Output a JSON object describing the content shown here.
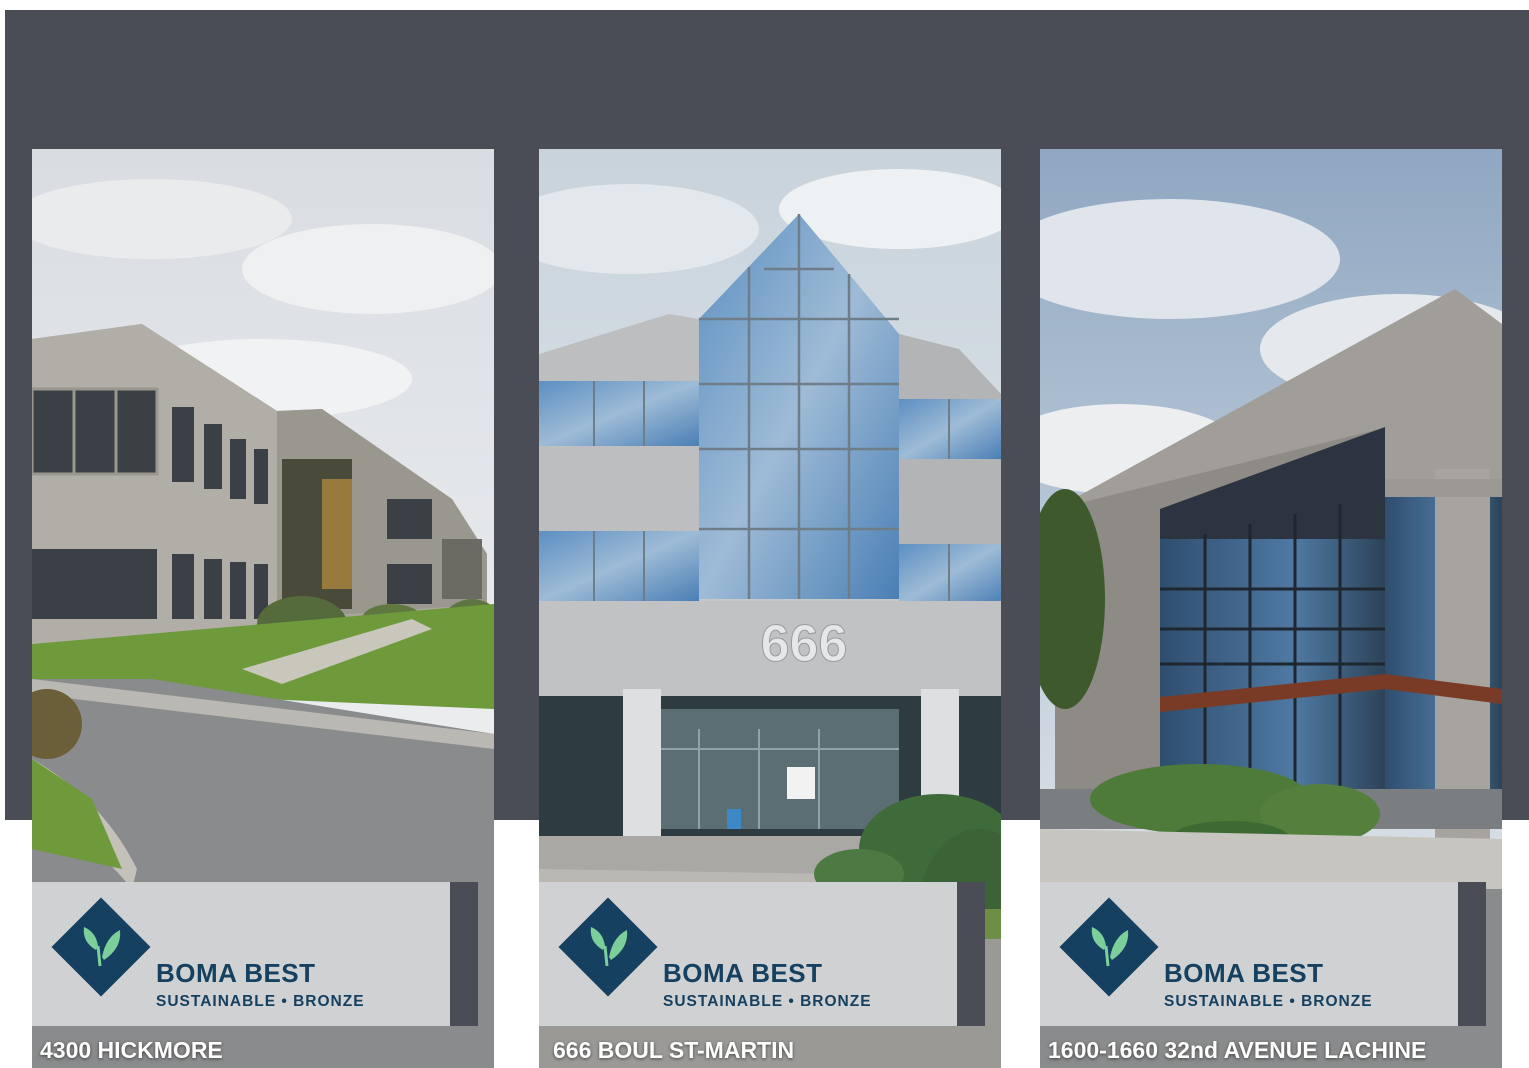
{
  "badge": {
    "title": "BOMA BEST",
    "subtitle": "SUSTAINABLE • BRONZE",
    "accent_color": "#16405f",
    "leaf_color": "#7ccf9a",
    "icon": "leaf-icon"
  },
  "buildings": [
    {
      "address": "4300 HICKMORE"
    },
    {
      "address": "666 BOUL ST-MARTIN",
      "sign_number": "666"
    },
    {
      "address": "1600-1660 32nd AVENUE LACHINE"
    }
  ],
  "colors": {
    "backdrop": "#4a4d56",
    "badge_bg": "#cfd1d3"
  }
}
